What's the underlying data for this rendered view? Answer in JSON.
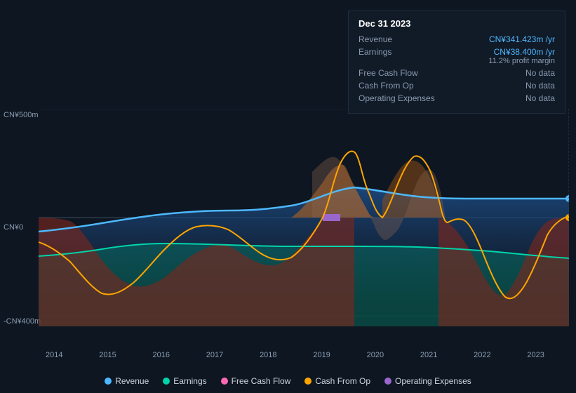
{
  "tooltip": {
    "date": "Dec 31 2023",
    "rows": [
      {
        "label": "Revenue",
        "value": "CN¥341.423m /yr",
        "isData": true
      },
      {
        "label": "Earnings",
        "value": "CN¥38.400m /yr",
        "isData": true
      },
      {
        "label": "profit_margin",
        "value": "11.2% profit margin",
        "isData": true
      },
      {
        "label": "Free Cash Flow",
        "value": "No data",
        "isData": false
      },
      {
        "label": "Cash From Op",
        "value": "No data",
        "isData": false
      },
      {
        "label": "Operating Expenses",
        "value": "No data",
        "isData": false
      }
    ]
  },
  "yAxis": {
    "top": "CN¥500m",
    "mid": "CN¥0",
    "bottom": "-CN¥400m"
  },
  "xAxis": {
    "labels": [
      "2014",
      "2015",
      "2016",
      "2017",
      "2018",
      "2019",
      "2020",
      "2021",
      "2022",
      "2023"
    ]
  },
  "legend": [
    {
      "label": "Revenue",
      "color": "#4db8ff"
    },
    {
      "label": "Earnings",
      "color": "#00d4aa"
    },
    {
      "label": "Free Cash Flow",
      "color": "#ff69b4"
    },
    {
      "label": "Cash From Op",
      "color": "#ffa500"
    },
    {
      "label": "Operating Expenses",
      "color": "#9966cc"
    }
  ],
  "colors": {
    "revenue": "#4db8ff",
    "earnings": "#00d4aa",
    "freeCashFlow": "#ff69b4",
    "cashFromOp": "#ffa500",
    "operatingExpenses": "#9966cc",
    "revenueArea": "rgba(30,80,140,0.6)",
    "earningsArea": "rgba(0,160,130,0.4)",
    "cashFromOpArea": "rgba(100,40,30,0.7)",
    "cashFromOpPosArea": "rgba(150,90,30,0.5)"
  }
}
